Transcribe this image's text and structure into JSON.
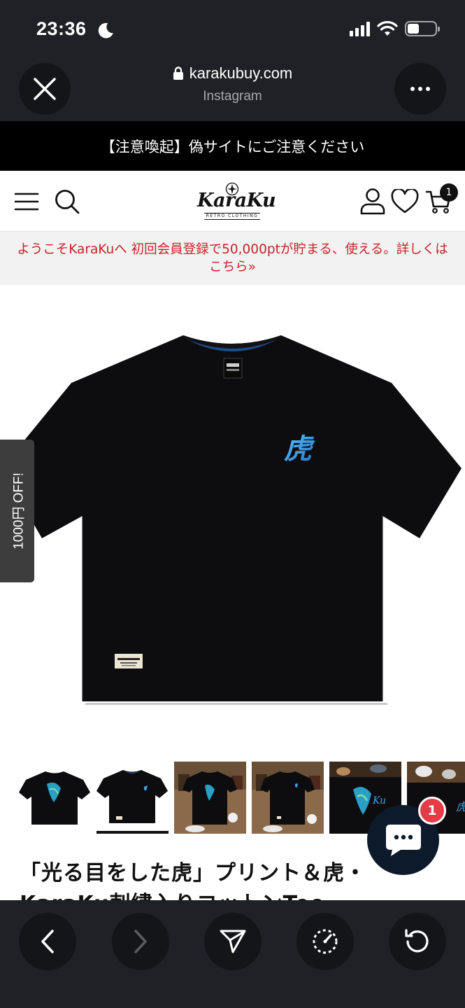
{
  "status_bar": {
    "time": "23:36"
  },
  "browser": {
    "domain": "karakubuy.com",
    "source": "Instagram"
  },
  "announcement": "【注意喚起】偽サイトにご注意ください",
  "header": {
    "logo_text": "KaraKu",
    "logo_subtext": "RETRO CLOTHING",
    "cart_count": "1"
  },
  "promo": "ようこそKaraKuへ 初回会員登録で50,000ptが貯まる、使える。詳しくはこちら»",
  "side_tab": "1000円 OFF!",
  "product": {
    "image_kanji": "虎",
    "title": "「光る目をした虎」プリント＆虎・KaraKu刺繍入りコットンTee"
  },
  "thumbnails": [
    {
      "name": "front-print"
    },
    {
      "name": "back-embroidery",
      "active": true
    },
    {
      "name": "hanger-front"
    },
    {
      "name": "hanger-back"
    },
    {
      "name": "print-closeup"
    },
    {
      "name": "embroidery-closeup"
    }
  ],
  "chat": {
    "unread": "1"
  },
  "colors": {
    "chrome_bg": "#1f2126",
    "button_bg": "#141519",
    "promo_text": "#c6232a",
    "promo_bg": "#f2f2f2",
    "chat_bg": "#0c1a2c",
    "chat_badge": "#e63a46",
    "shirt": "#0d0d0f",
    "embroidery": "#3aa3ea"
  }
}
